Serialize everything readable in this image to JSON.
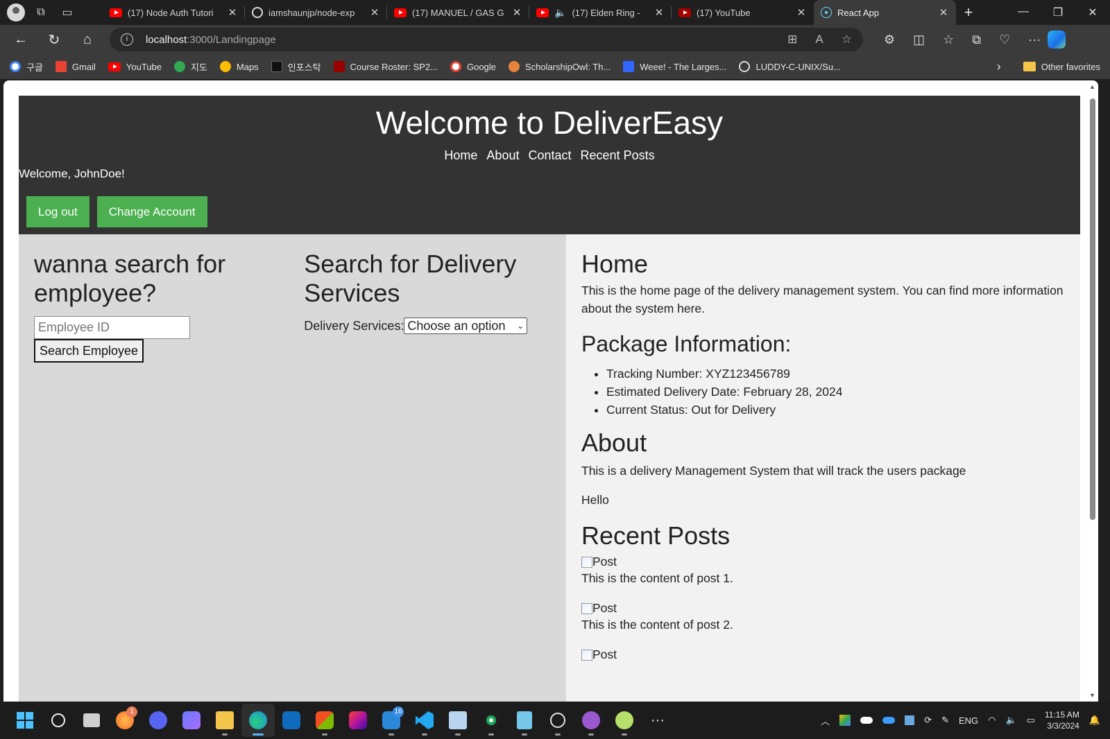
{
  "browser": {
    "tabs": [
      {
        "title": "(17) Node Auth Tutori",
        "icon": "youtube-icon"
      },
      {
        "title": "iamshaunjp/node-exp",
        "icon": "github-icon"
      },
      {
        "title": "(17) MANUEL / GAS G",
        "icon": "youtube-icon"
      },
      {
        "title": "(17) Elden Ring -",
        "icon": "youtube-icon"
      },
      {
        "title": "(17) YouTube",
        "icon": "youtube-icon"
      },
      {
        "title": "React App",
        "icon": "react-icon"
      }
    ],
    "address": {
      "host": "localhost",
      "path": ":3000/Landingpage"
    },
    "bookmarks": [
      "구글",
      "Gmail",
      "YouTube",
      "지도",
      "Maps",
      "인포스탁",
      "Course Roster: SP2...",
      "Google",
      "ScholarshipOwl: Th...",
      "Weee! - The Larges...",
      "LUDDY-C-UNIX/Su..."
    ],
    "other_favorites": "Other favorites"
  },
  "header": {
    "title": "Welcome to DeliverEasy",
    "nav": [
      "Home",
      "About",
      "Contact",
      "Recent Posts"
    ],
    "welcome": "Welcome, JohnDoe!",
    "logout": "Log out",
    "change_account": "Change Account"
  },
  "employee_search": {
    "heading": "wanna search for employee?",
    "placeholder": "Employee ID",
    "button": "Search Employee"
  },
  "delivery_search": {
    "heading": "Search for Delivery Services",
    "label": "Delivery Services:",
    "selected": "Choose an option"
  },
  "home": {
    "heading": "Home",
    "text": "This is the home page of the delivery management system. You can find more information about the system here."
  },
  "package": {
    "heading": "Package Information:",
    "items": [
      "Tracking Number: XYZ123456789",
      "Estimated Delivery Date: February 28, 2024",
      "Current Status: Out for Delivery"
    ]
  },
  "about": {
    "heading": "About",
    "text": "This is a delivery Management System that will track the users package",
    "hello": "Hello"
  },
  "recent_posts": {
    "heading": "Recent Posts",
    "posts": [
      {
        "alt": "Post",
        "content": "This is the content of post 1."
      },
      {
        "alt": "Post",
        "content": "This is the content of post 2."
      },
      {
        "alt": "Post",
        "content": ""
      }
    ]
  },
  "taskbar": {
    "badges": {
      "firefox": "1",
      "store": "16"
    },
    "lang": "ENG",
    "time": "11:15 AM",
    "date": "3/3/2024"
  },
  "colors": {
    "green": "#4caf50",
    "header": "#333333",
    "left_panel": "#d9d9d9",
    "right_panel": "#f2f2f2"
  }
}
